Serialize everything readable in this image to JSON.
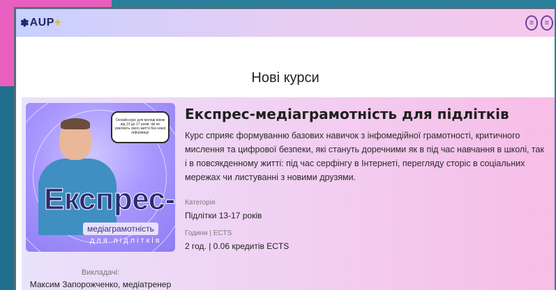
{
  "header": {
    "logo_text": "AUP",
    "logo_plus": "+",
    "logo_icon": "paw-icon",
    "buttons": [
      {
        "icon": "menu-icon",
        "glyph": "≡"
      },
      {
        "icon": "menu-icon",
        "glyph": "≡"
      }
    ]
  },
  "section": {
    "title": "Нові курси"
  },
  "course": {
    "image_texts": {
      "big": "Експрес-",
      "mid": "медіаграмотність",
      "small": "для підлітків",
      "speech": "Онлайн-курс для молоді віком від 13 до 17 років, які не уявляють свого життя без нової інформації"
    },
    "instructors_label": "Викладачі:",
    "instructor_name": "Максим Запорожченко, медіатренер",
    "title": "Експрес-медіаграмотність для підлітків",
    "description": "Курс сприяє формуванню базових навичок з інфомедійної грамотності, критичного мислення та цифрової безпеки, які стануть доречними як в під час навчання в школі, так і в повсякденному житті: під час серфінгу в Інтернеті, перегляду сторіс в соціальних мережах чи листуванні з новими друзями.",
    "category_label": "Категорія",
    "category_value": "Підлітки 13-17 років",
    "hours_label": "Години | ECTS",
    "hours_value": "2 год. | 0.06 кредитів ECTS"
  },
  "colors": {
    "accent": "#6b3fa0",
    "logo": "#1c2a6b",
    "logo_plus": "#f0b400"
  }
}
